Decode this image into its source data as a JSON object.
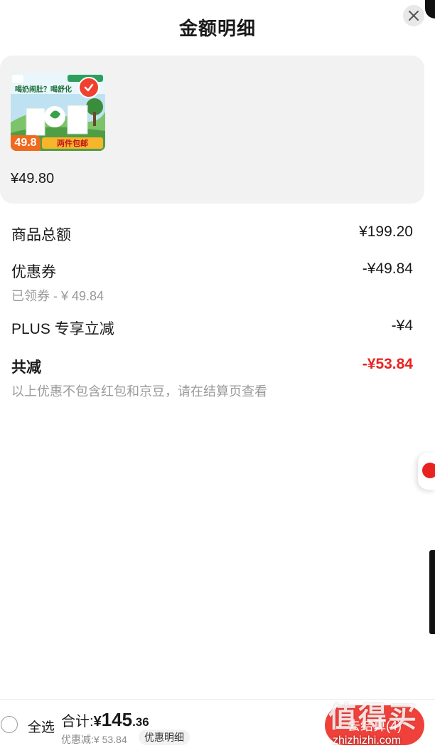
{
  "header": {
    "title": "金额明细",
    "close_icon": "close-icon"
  },
  "product": {
    "price": "¥49.80",
    "thumb_price": "49.8",
    "thumb_tag": "两件包邮",
    "thumb_slogan": "喝奶闹肚？喝舒化",
    "selected": true
  },
  "summary": {
    "subtotal_label": "商品总额",
    "subtotal_value": "¥199.20",
    "coupon_label": "优惠券",
    "coupon_value": "-¥49.84",
    "coupon_sub": "已领券 - ¥ 49.84",
    "plus_label": "PLUS 专享立减",
    "plus_value": "-¥4",
    "total_label": "共减",
    "total_value": "-¥53.84",
    "note": "以上优惠不包含红包和京豆，请在结算页查看"
  },
  "bottom_bar": {
    "select_all": "全选",
    "total_prefix": "合计:",
    "currency": "¥",
    "total_int": "145",
    "total_dec": ".36",
    "discount_text": "优惠减:¥ 53.84",
    "detail_label": "优惠明细",
    "checkout_label": "去结算(4)"
  },
  "watermark": {
    "text": "值得买",
    "url": "zhizhizhi.com"
  },
  "colors": {
    "accent_red": "#e8231f",
    "button_red": "#f0403a",
    "card_bg": "#f2f2f2"
  }
}
